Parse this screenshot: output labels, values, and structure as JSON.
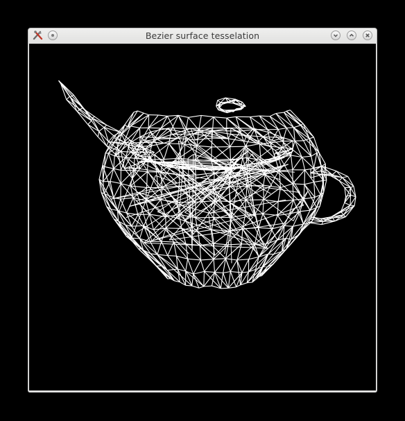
{
  "window": {
    "title": "Bezier surface tesselation"
  },
  "titlebar": {
    "icons": {
      "app": "tools-icon",
      "menu": "menu-dot-icon",
      "minimize": "chevron-down-icon",
      "maximize": "chevron-up-icon",
      "close": "close-icon"
    }
  },
  "viewport": {
    "background": "#000000",
    "wire_color": "#ffffff",
    "scene": "teapot-wireframe"
  }
}
